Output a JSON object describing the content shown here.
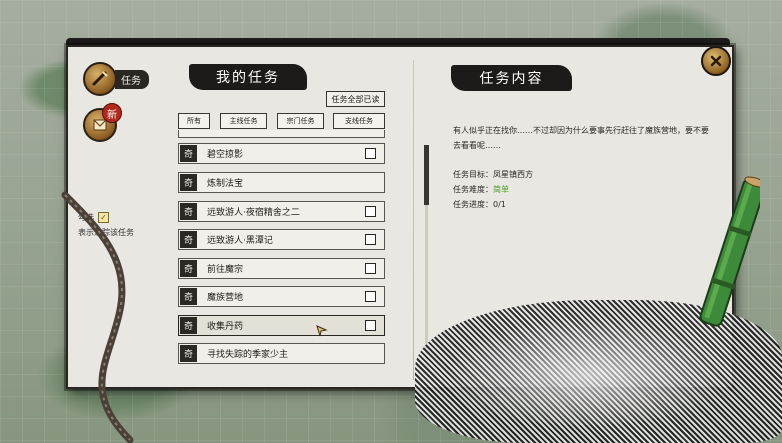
{
  "sidebar": {
    "task_tab_label": "任务",
    "new_badge": "新",
    "hint_line1": "勾选",
    "hint_mark": "✓",
    "hint_line2": "表示追踪该任务"
  },
  "quest_panel": {
    "title": "我的任务",
    "mark_all_read": "任务全部已读",
    "filters": [
      "所有",
      "主线任务",
      "宗门任务",
      "支线任务"
    ],
    "icon_label": "奇",
    "quests": [
      {
        "name": "碧空掠影",
        "tracked": false,
        "has_checkbox": true
      },
      {
        "name": "炼制法宝",
        "tracked": false,
        "has_checkbox": false
      },
      {
        "name": "远致游人·夜宿精舍之二",
        "tracked": false,
        "has_checkbox": true
      },
      {
        "name": "远致游人·黑潭记",
        "tracked": false,
        "has_checkbox": true
      },
      {
        "name": "前往魔宗",
        "tracked": false,
        "has_checkbox": true
      },
      {
        "name": "魔族营地",
        "tracked": false,
        "has_checkbox": true
      },
      {
        "name": "收集丹药",
        "tracked": false,
        "has_checkbox": true,
        "selected": true
      },
      {
        "name": "寻找失踪的季家少主",
        "tracked": false,
        "has_checkbox": false
      }
    ]
  },
  "detail_panel": {
    "title": "任务内容",
    "description": "有人似乎正在找你……不过却因为什么要事先行赶往了魔族营地，要不要去看看呢……",
    "target_label": "任务目标：",
    "target_value": "凤星镇西方",
    "difficulty_label": "任务难度：",
    "difficulty_value": "简单",
    "progress_label": "任务进度：",
    "progress_value": "0/1"
  },
  "colors": {
    "ink": "#1d1b19",
    "paper": "#e9e7e1",
    "easy_green": "#4f9b2c",
    "badge_red": "#b22a1c"
  },
  "icons": {
    "close": "close-icon",
    "task_tab": "scroll-brush-icon",
    "new_tab": "letter-icon"
  }
}
